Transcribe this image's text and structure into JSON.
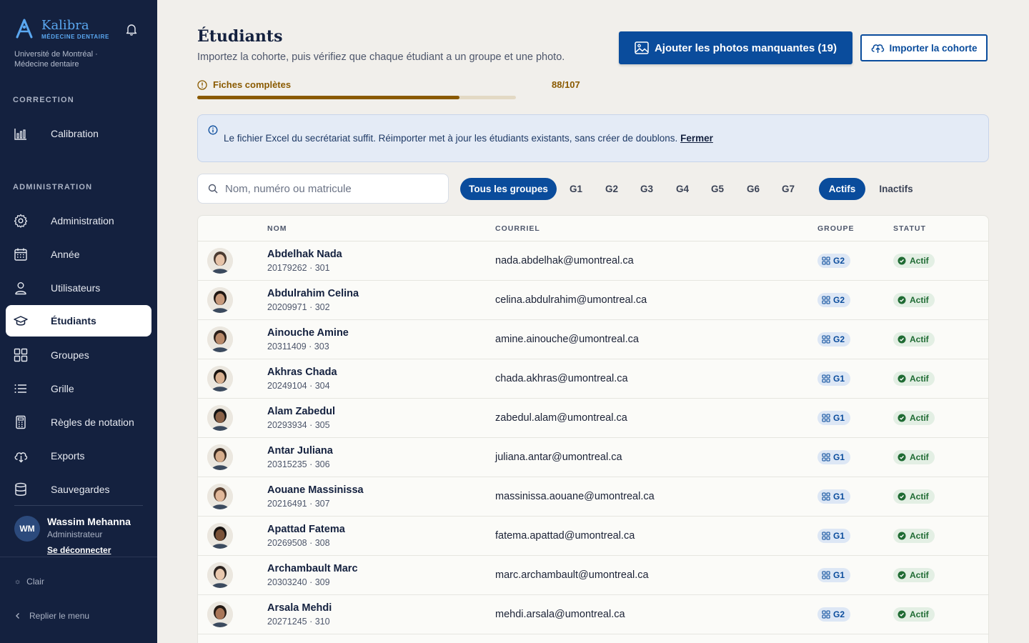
{
  "sidebar": {
    "brand_name": "Kalibra",
    "brand_sub": "MÉDECINE DENTAIRE",
    "institution": "Université de Montréal · Médecine dentaire",
    "section_correction": "CORRECTION",
    "section_admin": "ADMINISTRATION",
    "items": [
      {
        "label": "Calibration",
        "icon": "chart-bars-icon"
      },
      {
        "label": "Administration",
        "icon": "gear-icon"
      },
      {
        "label": "Année",
        "icon": "calendar-icon"
      },
      {
        "label": "Utilisateurs",
        "icon": "user-icon"
      },
      {
        "label": "Étudiants",
        "icon": "graduation-cap-icon",
        "active": true
      },
      {
        "label": "Groupes",
        "icon": "grid-icon"
      },
      {
        "label": "Grille",
        "icon": "list-icon"
      },
      {
        "label": "Règles de notation",
        "icon": "calculator-icon"
      },
      {
        "label": "Exports",
        "icon": "cloud-download-icon"
      },
      {
        "label": "Sauvegardes",
        "icon": "database-icon"
      }
    ],
    "user": {
      "initials": "WM",
      "name": "Wassim Mehanna",
      "role": "Administrateur",
      "logout": "Se déconnecter"
    },
    "theme_label": "Clair",
    "collapse_label": "Replier le menu"
  },
  "header": {
    "title": "Étudiants",
    "subtitle": "Importez la cohorte, puis vérifiez que chaque étudiant a un groupe et une photo.",
    "primary_button": "Ajouter les photos manquantes (19)",
    "secondary_button": "Importer la cohorte"
  },
  "progress": {
    "label": "Fiches complètes",
    "count_text": "88/107",
    "fraction": 0.8224
  },
  "info": {
    "text": "Le fichier Excel du secrétariat suffit. Réimporter met à jour les étudiants existants, sans créer de doublons.",
    "close_label": "Fermer"
  },
  "search": {
    "placeholder": "Nom, numéro ou matricule"
  },
  "filters": {
    "groups": [
      "Tous les groupes",
      "G1",
      "G2",
      "G3",
      "G4",
      "G5",
      "G6",
      "G7"
    ],
    "status": [
      "Actifs",
      "Inactifs"
    ]
  },
  "table": {
    "headers": {
      "name": "NOM",
      "email": "COURRIEL",
      "group": "GROUPE",
      "status": "STATUT"
    },
    "rows": [
      {
        "name": "Abdelhak Nada",
        "meta": "20179262 · 301",
        "email": "nada.abdelhak@umontreal.ca",
        "group": "G2",
        "status": "Actif"
      },
      {
        "name": "Abdulrahim Celina",
        "meta": "20209971 · 302",
        "email": "celina.abdulrahim@umontreal.ca",
        "group": "G2",
        "status": "Actif"
      },
      {
        "name": "Ainouche Amine",
        "meta": "20311409 · 303",
        "email": "amine.ainouche@umontreal.ca",
        "group": "G2",
        "status": "Actif"
      },
      {
        "name": "Akhras Chada",
        "meta": "20249104 · 304",
        "email": "chada.akhras@umontreal.ca",
        "group": "G1",
        "status": "Actif"
      },
      {
        "name": "Alam Zabedul",
        "meta": "20293934 · 305",
        "email": "zabedul.alam@umontreal.ca",
        "group": "G1",
        "status": "Actif"
      },
      {
        "name": "Antar Juliana",
        "meta": "20315235 · 306",
        "email": "juliana.antar@umontreal.ca",
        "group": "G1",
        "status": "Actif"
      },
      {
        "name": "Aouane Massinissa",
        "meta": "20216491 · 307",
        "email": "massinissa.aouane@umontreal.ca",
        "group": "G1",
        "status": "Actif"
      },
      {
        "name": "Apattad Fatema",
        "meta": "20269508 · 308",
        "email": "fatema.apattad@umontreal.ca",
        "group": "G1",
        "status": "Actif"
      },
      {
        "name": "Archambault Marc",
        "meta": "20303240 · 309",
        "email": "marc.archambault@umontreal.ca",
        "group": "G1",
        "status": "Actif"
      },
      {
        "name": "Arsala Mehdi",
        "meta": "20271245 · 310",
        "email": "mehdi.arsala@umontreal.ca",
        "group": "G2",
        "status": "Actif"
      }
    ]
  },
  "colors": {
    "sidebar_bg": "#14213f",
    "primary": "#0a4c9c",
    "progress": "#8a5a00",
    "status_green": "#1f6b33"
  }
}
